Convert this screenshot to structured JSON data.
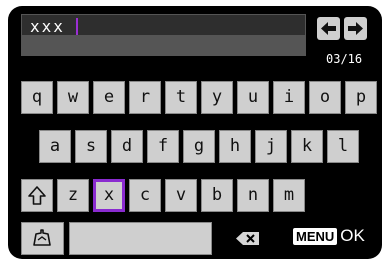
{
  "input": {
    "value": "xxx"
  },
  "counter": "03/16",
  "rows": [
    [
      "q",
      "w",
      "e",
      "r",
      "t",
      "y",
      "u",
      "i",
      "o",
      "p"
    ],
    [
      "a",
      "s",
      "d",
      "f",
      "g",
      "h",
      "j",
      "k",
      "l"
    ],
    [
      "z",
      "x",
      "c",
      "v",
      "b",
      "n",
      "m"
    ]
  ],
  "selected_key": "x",
  "footer": {
    "menu_label": "MENU",
    "ok_label": "OK"
  },
  "icons": {
    "left": "arrow-left-icon",
    "right": "arrow-right-icon",
    "shift": "shift-icon",
    "mode": "input-mode-icon",
    "delete": "backspace-icon"
  },
  "colors": {
    "selection": "#8a2bd0",
    "caret": "#9b2fd4"
  }
}
